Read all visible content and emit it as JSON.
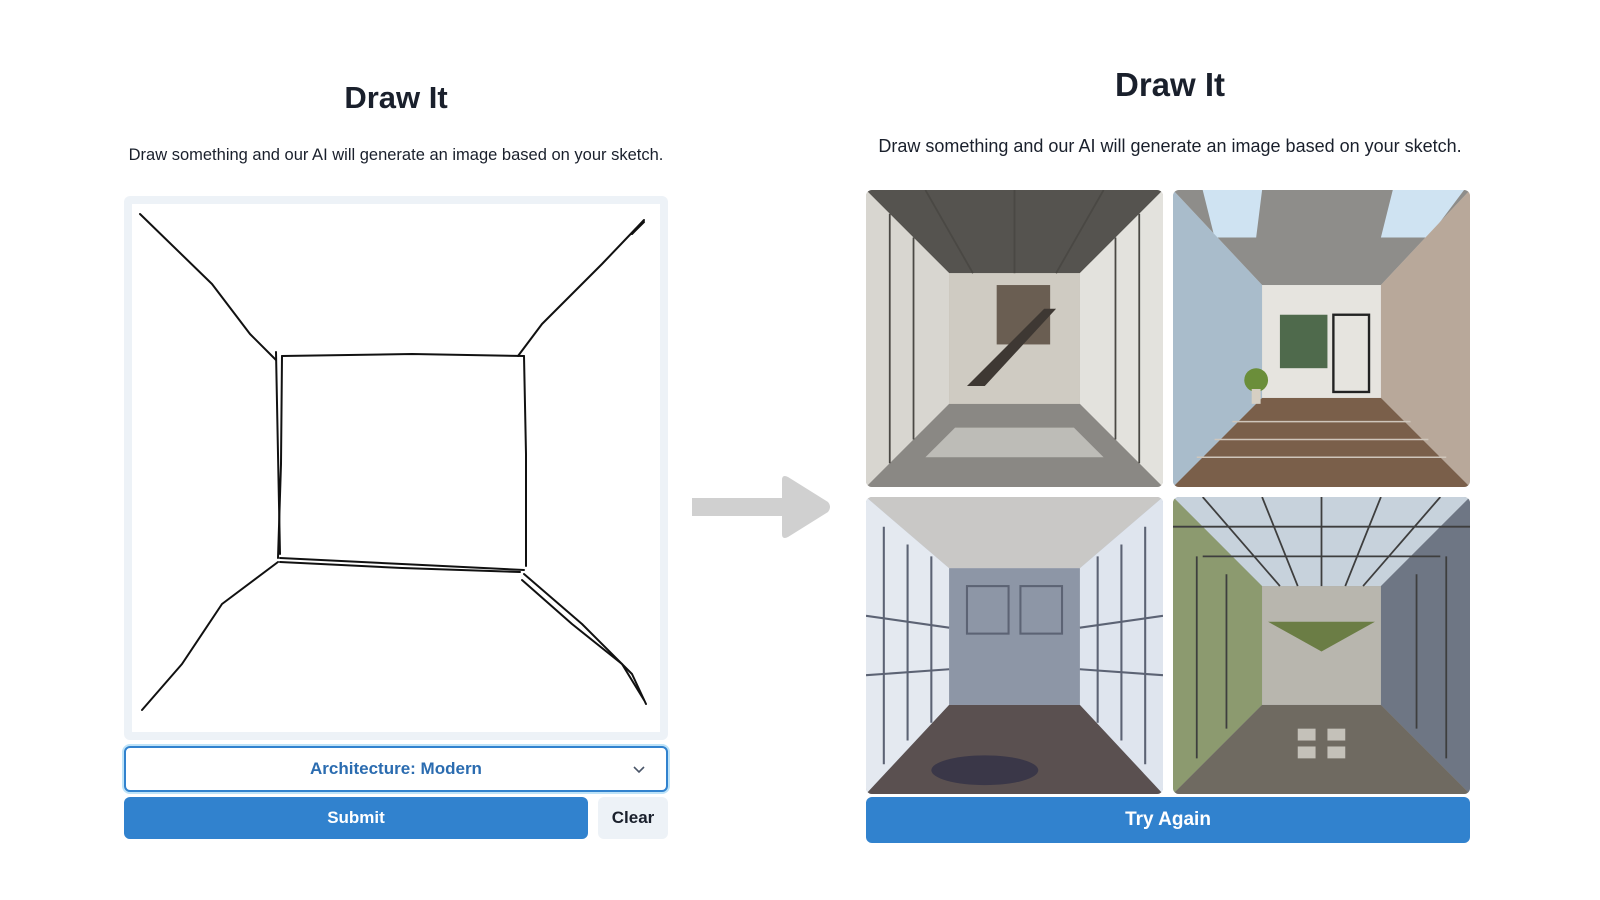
{
  "left_panel": {
    "title": "Draw It",
    "subtitle": "Draw something and our AI will generate an image based on your sketch.",
    "style_select": {
      "selected": "Architecture: Modern"
    },
    "submit_label": "Submit",
    "clear_label": "Clear"
  },
  "right_panel": {
    "title": "Draw It",
    "subtitle": "Draw something and our AI will generate an image based on your sketch.",
    "results": [
      {
        "icon": "generated-image-hallway-staircase"
      },
      {
        "icon": "generated-image-courtyard-plant"
      },
      {
        "icon": "generated-image-grid-window-room"
      },
      {
        "icon": "generated-image-glass-atrium"
      }
    ],
    "try_again_label": "Try Again"
  },
  "icons": {
    "arrow": "right-arrow-icon",
    "dropdown": "chevron-down-icon"
  },
  "colors": {
    "accent": "#3182ce",
    "accent_text": "#2b6cb0",
    "panel_bg": "#edf2f7",
    "arrow": "#d0d0d0",
    "text": "#1a202c"
  }
}
